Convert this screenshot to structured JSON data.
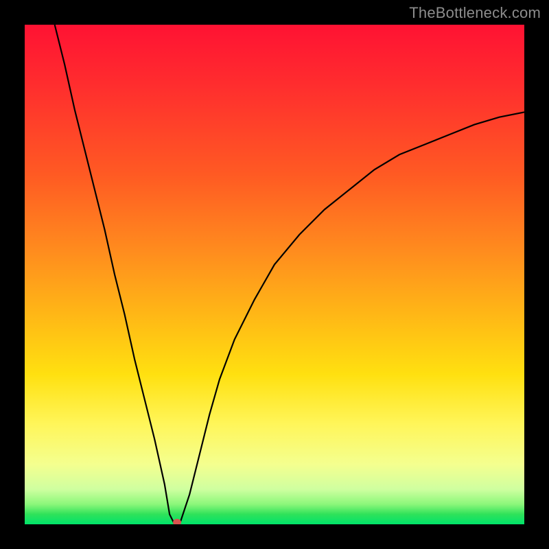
{
  "watermark": "TheBottleneck.com",
  "chart_data": {
    "type": "line",
    "title": "",
    "xlabel": "",
    "ylabel": "",
    "xlim": [
      0,
      100
    ],
    "ylim": [
      0,
      100
    ],
    "grid": false,
    "series": [
      {
        "name": "bottleneck-curve",
        "x": [
          6,
          8,
          10,
          12,
          14,
          16,
          18,
          20,
          22,
          24,
          26,
          28,
          29,
          30,
          31,
          33,
          35,
          37,
          39,
          42,
          46,
          50,
          55,
          60,
          65,
          70,
          75,
          80,
          85,
          90,
          95,
          100
        ],
        "y": [
          100,
          92,
          83,
          75,
          67,
          59,
          50,
          42,
          33,
          25,
          17,
          8,
          2,
          0,
          0,
          6,
          14,
          22,
          29,
          37,
          45,
          52,
          58,
          63,
          67,
          71,
          74,
          76,
          78,
          80,
          81.5,
          82.5
        ]
      }
    ],
    "annotations": [
      {
        "type": "marker",
        "name": "optimal-point",
        "x": 30.5,
        "y": 0
      }
    ],
    "colors": {
      "curve": "#000000",
      "gradient_top": "#ff1233",
      "gradient_mid": "#ffe010",
      "gradient_bottom": "#00e36a",
      "marker": "#d9534f"
    }
  }
}
